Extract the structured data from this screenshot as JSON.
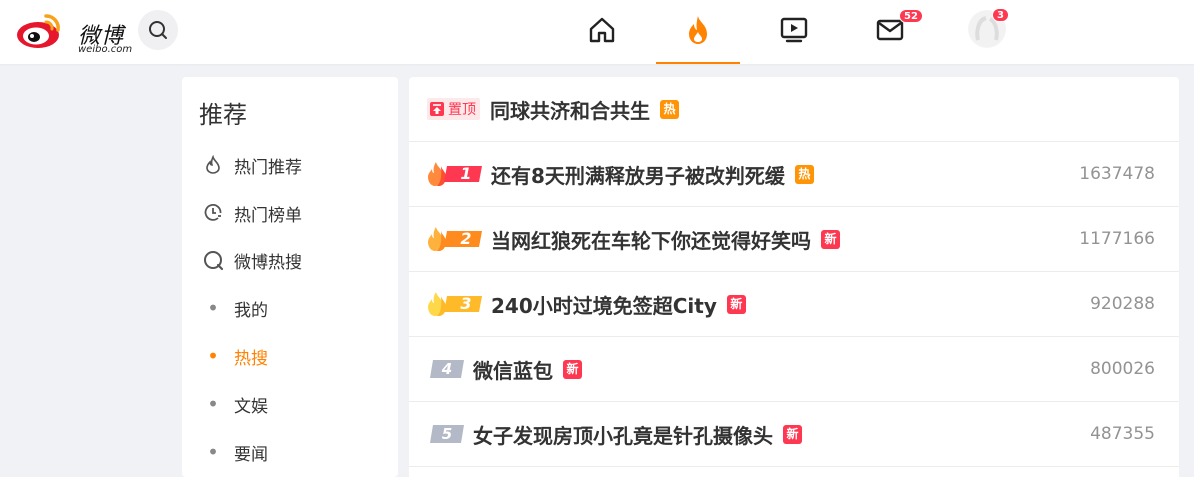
{
  "header": {
    "logo_text": "微博",
    "logo_sub": "weibo.com",
    "nav": [
      {
        "name": "home",
        "icon": "home-icon"
      },
      {
        "name": "hot",
        "icon": "fire-icon",
        "active": true
      },
      {
        "name": "video",
        "icon": "video-icon"
      },
      {
        "name": "messages",
        "icon": "mail-icon",
        "badge": "52"
      },
      {
        "name": "profile",
        "icon": "avatar",
        "badge": "3"
      }
    ],
    "colors": {
      "accent": "#ff8200",
      "badge": "#ff3852"
    }
  },
  "sidebar": {
    "title": "推荐",
    "items": [
      {
        "label": "热门推荐",
        "icon": "flame-outline-icon"
      },
      {
        "label": "热门榜单",
        "icon": "clock-chart-icon"
      },
      {
        "label": "微博热搜",
        "icon": "search-circle-icon"
      },
      {
        "label": "我的"
      },
      {
        "label": "热搜",
        "active": true
      },
      {
        "label": "文娱"
      },
      {
        "label": "要闻"
      }
    ]
  },
  "hot_list": {
    "pinned": {
      "label": "置顶",
      "title": "同球共济和合共生",
      "tag": "热"
    },
    "items": [
      {
        "rank": "1",
        "title": "还有8天刑满释放男子被改判死缓",
        "tag": "热",
        "count": "1637478"
      },
      {
        "rank": "2",
        "title": "当网红狼死在车轮下你还觉得好笑吗",
        "tag": "新",
        "count": "1177166"
      },
      {
        "rank": "3",
        "title": "240小时过境免签超City",
        "tag": "新",
        "count": "920288"
      },
      {
        "rank": "4",
        "title": "微信蓝包",
        "tag": "新",
        "count": "800026"
      },
      {
        "rank": "5",
        "title": "女子发现房顶小孔竟是针孔摄像头",
        "tag": "新",
        "count": "487355"
      }
    ]
  }
}
